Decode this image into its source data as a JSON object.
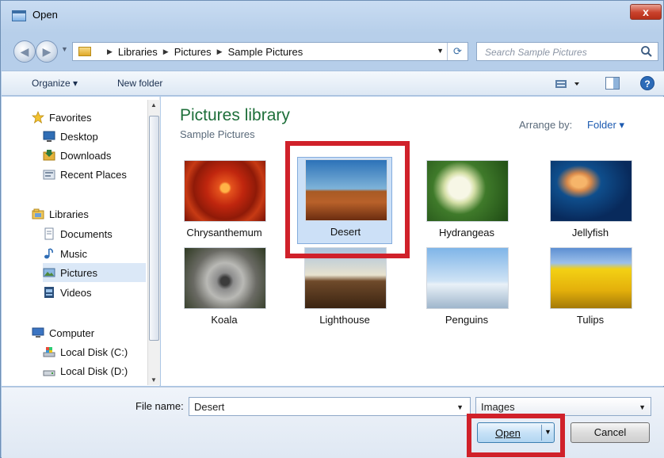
{
  "window": {
    "title": "Open",
    "close_label": "x"
  },
  "address": {
    "breadcrumbs": [
      "Libraries",
      "Pictures",
      "Sample Pictures"
    ]
  },
  "search": {
    "placeholder": "Search Sample Pictures"
  },
  "toolbar": {
    "organize_label": "Organize ▾",
    "new_folder_label": "New folder"
  },
  "navigation": {
    "favorites": {
      "label": "Favorites",
      "items": [
        "Desktop",
        "Downloads",
        "Recent Places"
      ]
    },
    "libraries": {
      "label": "Libraries",
      "items": [
        "Documents",
        "Music",
        "Pictures",
        "Videos"
      ]
    },
    "computer": {
      "label": "Computer",
      "items": [
        "Local Disk (C:)",
        "Local Disk (D:)"
      ]
    },
    "selected": "Pictures"
  },
  "content": {
    "title": "Pictures library",
    "subtitle": "Sample Pictures",
    "arrange_label": "Arrange by:",
    "arrange_value": "Folder ▾",
    "items": [
      "Chrysanthemum",
      "Desert",
      "Hydrangeas",
      "Jellyfish",
      "Koala",
      "Lighthouse",
      "Penguins",
      "Tulips"
    ],
    "selected": "Desert"
  },
  "footer": {
    "file_name_label": "File name:",
    "file_name_value": "Desert",
    "filter_value": "Images",
    "open_label": "Open",
    "cancel_label": "Cancel"
  },
  "colors": {
    "highlight_box": "#d0212a",
    "library_title": "#1e6f3a",
    "selection": "#cce0f7"
  }
}
